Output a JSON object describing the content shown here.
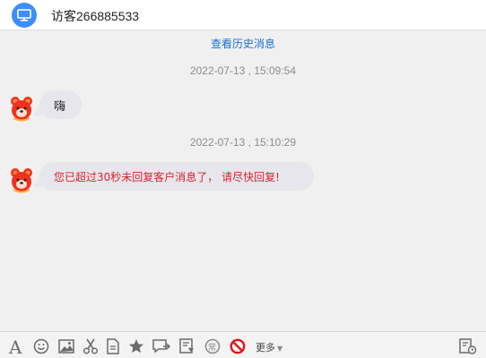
{
  "header": {
    "title": "访客266885533",
    "badge_icon": "monitor-icon",
    "badge_color": "#3e8ef7"
  },
  "chat": {
    "history_link": "查看历史消息",
    "messages": [
      {
        "timestamp": "2022-07-13 , 15:09:54",
        "avatar_icon": "bear-avatar-icon",
        "text": "嗨",
        "text_color": "#222222"
      },
      {
        "timestamp": "2022-07-13 , 15:10:29",
        "avatar_icon": "bear-avatar-icon",
        "text": "您已超过30秒未回复客户消息了， 请尽快回复!",
        "text_color": "#d4262c"
      }
    ]
  },
  "toolbar": {
    "tools": [
      "font-icon",
      "emoji-icon",
      "image-icon",
      "screenshot-scissors-icon",
      "file-icon",
      "favorite-star-icon",
      "transfer-chat-icon",
      "evaluation-icon",
      "common-phrases-icon",
      "block-icon"
    ],
    "more_label": "更多",
    "history_icon": "chat-history-icon"
  }
}
